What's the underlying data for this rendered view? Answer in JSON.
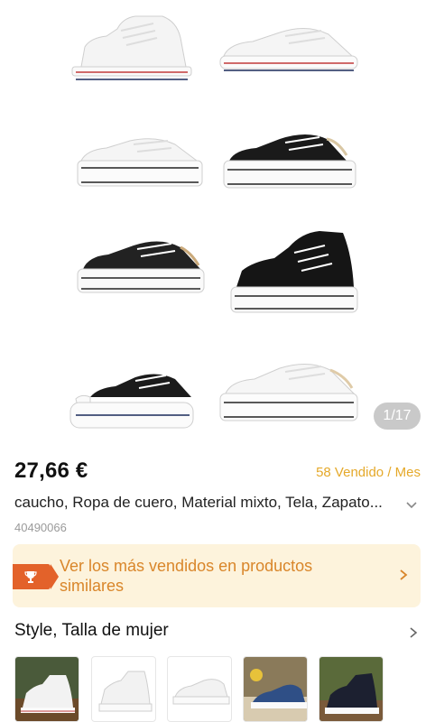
{
  "gallery": {
    "counter": "1/17",
    "shoes": [
      {
        "name": "white-high-top",
        "color": "#ffffff"
      },
      {
        "name": "white-low-top",
        "color": "#ffffff"
      },
      {
        "name": "white-platform-low",
        "color": "#ffffff"
      },
      {
        "name": "black-platform-low",
        "color": "#1a1a1a"
      },
      {
        "name": "black-leather-low",
        "color": "#222222"
      },
      {
        "name": "black-platform-high",
        "color": "#151515"
      },
      {
        "name": "black-move-low",
        "color": "#1b1b1b"
      },
      {
        "name": "white-lift-low",
        "color": "#ffffff"
      }
    ]
  },
  "product": {
    "price": "27,66 €",
    "sold": "58 Vendido / Mes",
    "materials": "caucho, Ropa de cuero, Material mixto, Tela, Zapato...",
    "sku": "40490066"
  },
  "banner": {
    "text": "Ver los más vendidos en productos similares",
    "icon": "trophy-icon",
    "accent": "#e3622a",
    "text_color": "#d9862a",
    "background": "#fdf3dc"
  },
  "style_section": {
    "title": "Style, Talla de mujer",
    "thumbnails": [
      "thumb-white-high-top",
      "thumb-white-high",
      "thumb-white-low",
      "thumb-blue-low",
      "thumb-black-high"
    ]
  },
  "colors": {
    "sold_color": "#e5a92a",
    "sku_color": "#9a9a9a"
  }
}
